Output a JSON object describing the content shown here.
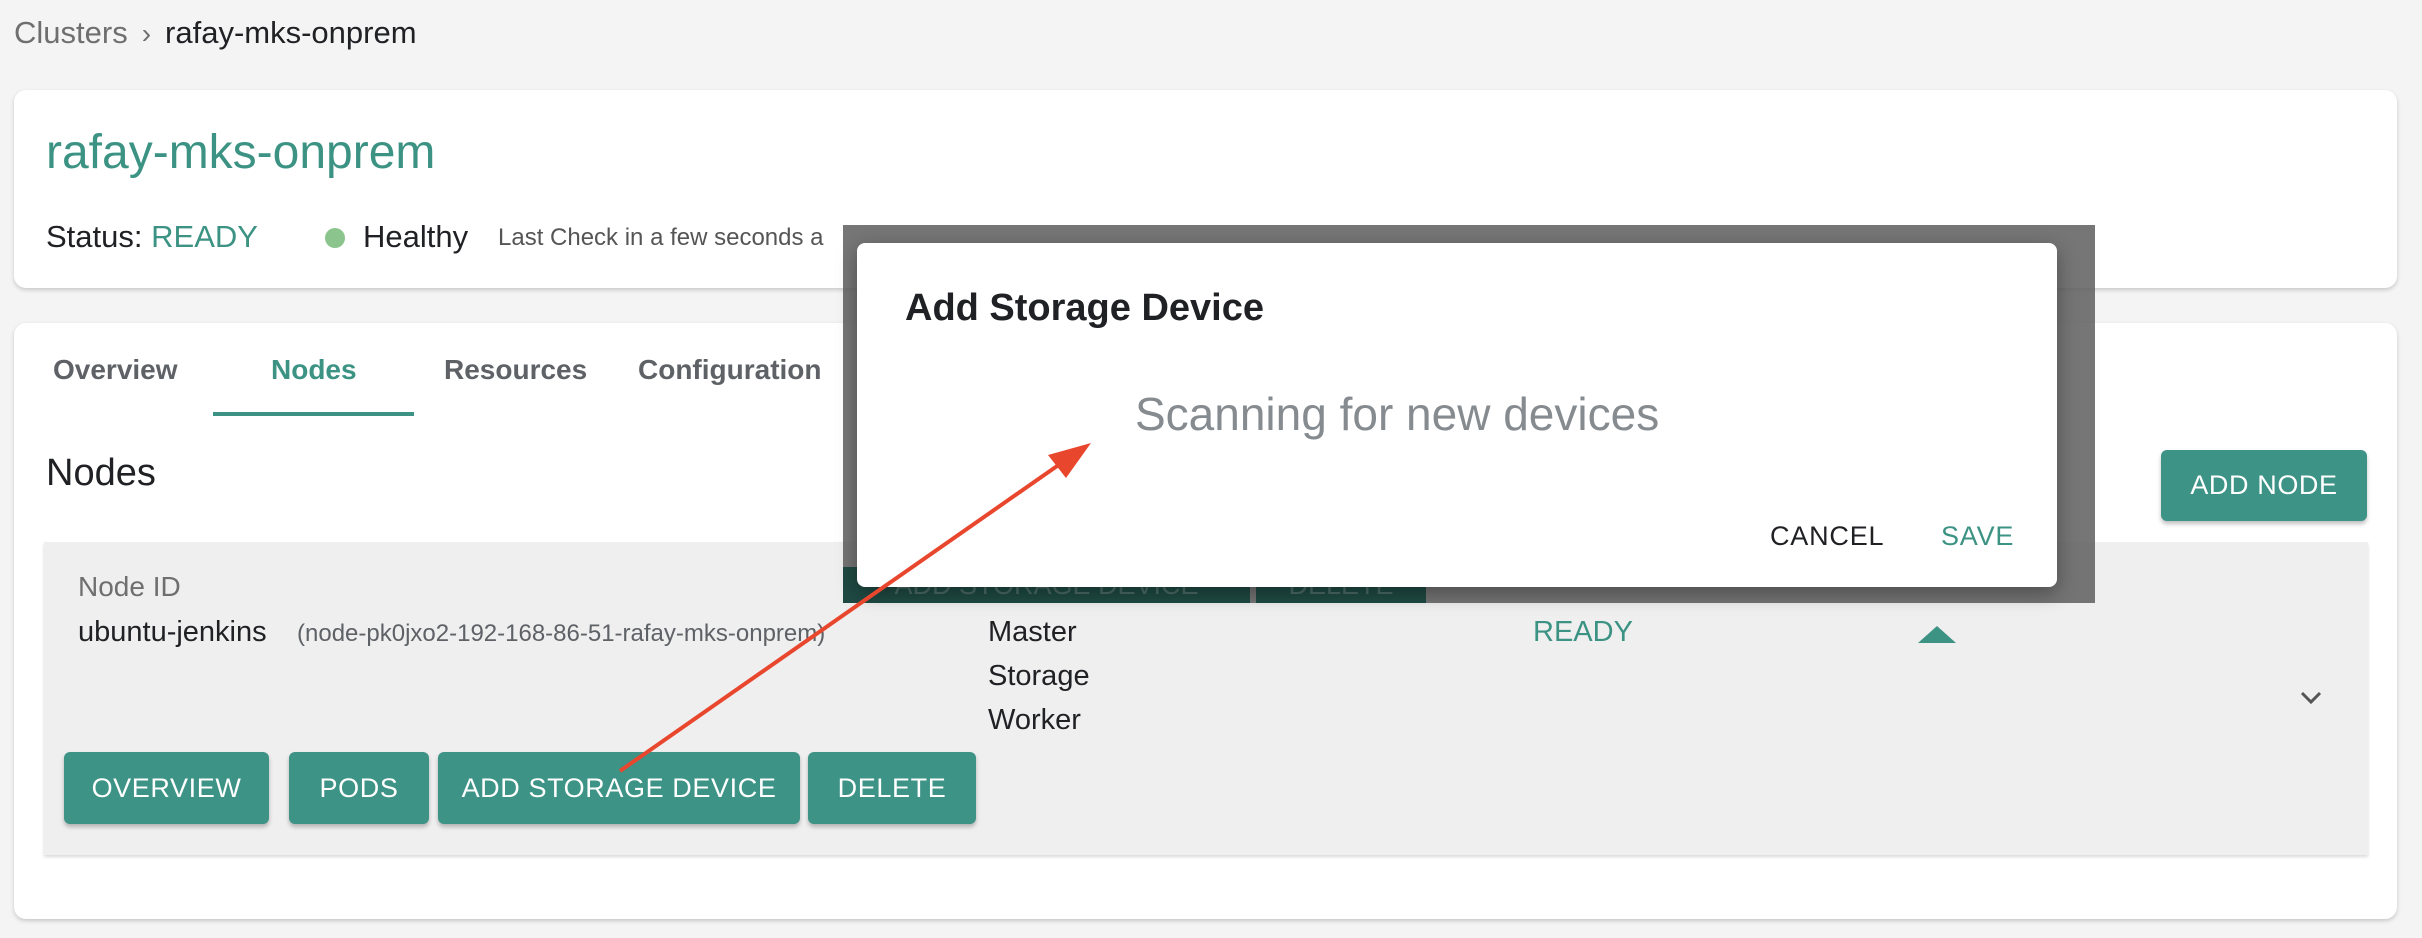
{
  "breadcrumb": {
    "parent": "Clusters",
    "separator": "›",
    "current": "rafay-mks-onprem"
  },
  "cluster": {
    "name": "rafay-mks-onprem",
    "status_label": "Status:",
    "status_value": "READY",
    "health": "Healthy",
    "last_check": "Last Check in a few seconds a"
  },
  "tabs": [
    "Overview",
    "Nodes",
    "Resources",
    "Configuration"
  ],
  "nodes_section": {
    "heading": "Nodes",
    "add_node_label": "ADD NODE"
  },
  "node": {
    "id_label": "Node ID",
    "name": "ubuntu-jenkins",
    "full_id": "(node-pk0jxo2-192-168-86-51-rafay-mks-onprem)",
    "roles": [
      "Master",
      "Storage",
      "Worker"
    ],
    "status": "READY",
    "actions": {
      "overview": "OVERVIEW",
      "pods": "PODS",
      "add_storage": "ADD STORAGE DEVICE",
      "delete": "DELETE"
    }
  },
  "background_ghost": {
    "add_storage": "ADD STORAGE DEVICE",
    "delete": "DELETE"
  },
  "dialog": {
    "title": "Add Storage Device",
    "message": "Scanning for new devices",
    "cancel_label": "CANCEL",
    "save_label": "SAVE"
  },
  "colors": {
    "accent": "#3c9384",
    "button": "#3d9386",
    "annotation_arrow": "#e8472e",
    "health_dot": "#8bc58d"
  }
}
